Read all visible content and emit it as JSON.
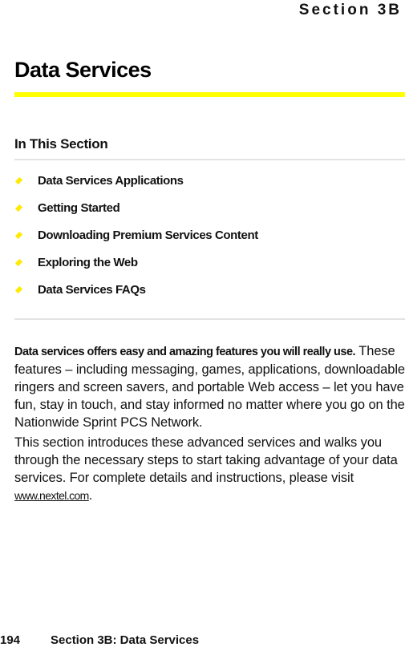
{
  "header": {
    "section_tab": "Section 3B"
  },
  "title": "Data Services",
  "in_this_section": {
    "heading": "In This Section",
    "items": [
      {
        "label": "Data Services Applications"
      },
      {
        "label": "Getting Started"
      },
      {
        "label": "Downloading Premium Services Content"
      },
      {
        "label": "Exploring the Web"
      },
      {
        "label": "Data Services FAQs"
      }
    ]
  },
  "body": {
    "p1_lead": "Data services offers easy and amazing features you will really use.",
    "p1_rest": "These features – including messaging, games, applications, downloadable ringers and screen savers, and portable Web access – let you have fun, stay in touch, and stay informed no matter where you go on the Nationwide Sprint PCS Network.",
    "p2_text": "This section introduces these advanced services and walks you through the necessary steps to start taking advantage of your data services. For complete details and instructions, please visit ",
    "p2_link": "www.nextel.com",
    "p2_end": "."
  },
  "footer": {
    "page_number": "194",
    "section_label": "Section 3B: Data Services"
  },
  "colors": {
    "accent": "#ffff00",
    "bullet": "#ffea00",
    "rule": "#e3e3e3"
  }
}
